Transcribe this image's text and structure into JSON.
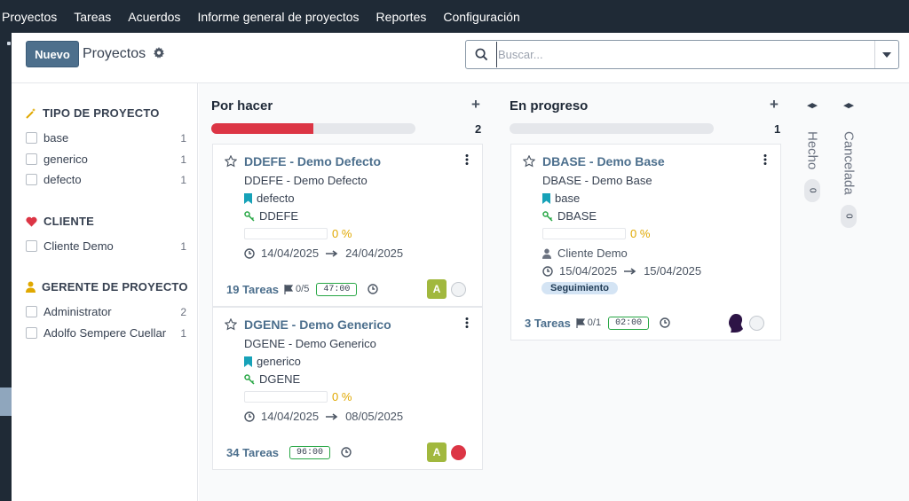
{
  "nav": {
    "items": [
      "Proyectos",
      "Tareas",
      "Acuerdos",
      "Informe general de proyectos",
      "Reportes",
      "Configuración"
    ]
  },
  "control": {
    "new_label": "Nuevo",
    "title": "Proyectos",
    "search_placeholder": "Buscar..."
  },
  "sidebar": {
    "groups": [
      {
        "title": "TIPO DE PROYECTO",
        "icon": "wand-icon",
        "items": [
          {
            "label": "base",
            "count": "1"
          },
          {
            "label": "generico",
            "count": "1"
          },
          {
            "label": "defecto",
            "count": "1"
          }
        ]
      },
      {
        "title": "CLIENTE",
        "icon": "heart-icon",
        "items": [
          {
            "label": "Cliente Demo",
            "count": "1"
          }
        ]
      },
      {
        "title": "GERENTE DE PROYECTO",
        "icon": "user-icon",
        "items": [
          {
            "label": "Administrator",
            "count": "2"
          },
          {
            "label": "Adolfo Sempere Cuellar",
            "count": "1"
          }
        ]
      }
    ]
  },
  "columns": [
    {
      "title": "Por hacer",
      "count": "2",
      "progress": 0.5,
      "cards": [
        {
          "title": "DDEFE - Demo Defecto",
          "subtitle": "DDEFE - Demo Defecto",
          "tag": "defecto",
          "code": "DDEFE",
          "progress_text": "0 %",
          "date_start": "14/04/2025",
          "date_end": "24/04/2025",
          "tasks": "19 Tareas",
          "milestones": "0/5",
          "hours": "47:00",
          "avatar": "A",
          "status_color": "#f1f3f5"
        },
        {
          "title": "DGENE - Demo Generico",
          "subtitle": "DGENE - Demo Generico",
          "tag": "generico",
          "code": "DGENE",
          "progress_text": "0 %",
          "date_start": "14/04/2025",
          "date_end": "08/05/2025",
          "tasks": "34 Tareas",
          "hours": "96:00",
          "avatar": "A",
          "status_color": "#dc3545"
        }
      ]
    },
    {
      "title": "En progreso",
      "count": "1",
      "progress": 0,
      "cards": [
        {
          "title": "DBASE - Demo Base",
          "subtitle": "DBASE - Demo Base",
          "tag": "base",
          "code": "DBASE",
          "progress_text": "0 %",
          "customer": "Cliente Demo",
          "date_start": "15/04/2025",
          "date_end": "15/04/2025",
          "stage_badge": "Seguimiento",
          "tasks": "3 Tareas",
          "milestones": "0/1",
          "hours": "02:00",
          "status_color": "#f1f3f5"
        }
      ]
    }
  ],
  "folded": [
    {
      "title": "Hecho",
      "count": "0"
    },
    {
      "title": "Cancelada",
      "count": "0"
    }
  ],
  "colors": {
    "topbar": "#1f2a36",
    "primary": "#4d6f8c",
    "link": "#4c6f8d",
    "danger": "#dc3545",
    "warning": "#e0a800",
    "success": "#28a745",
    "avatar": "#a1b83e"
  }
}
